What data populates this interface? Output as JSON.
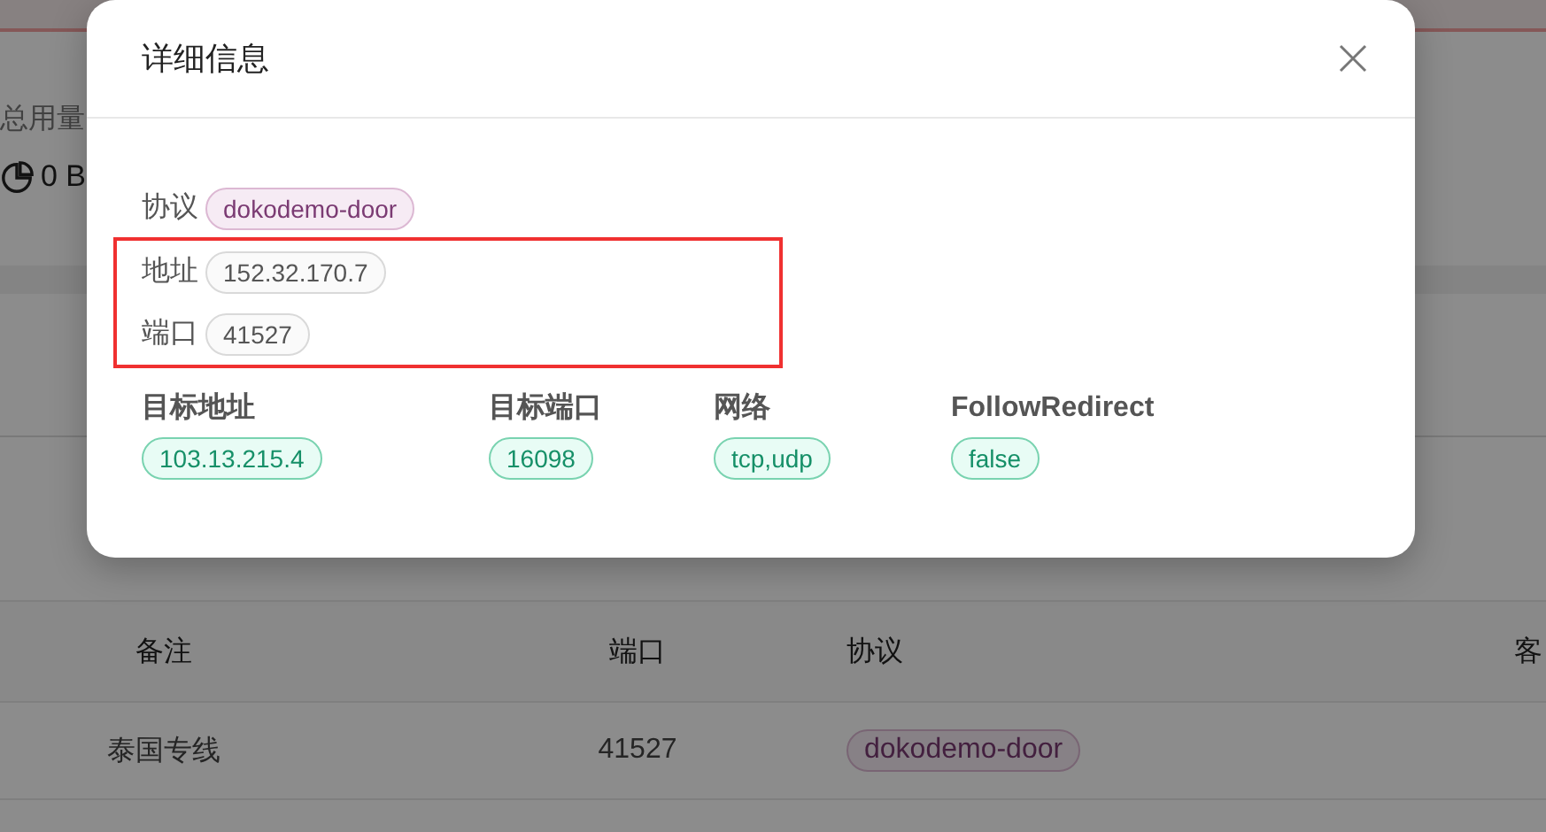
{
  "background": {
    "usage_label": "总用量",
    "usage_value": "0 B",
    "table": {
      "columns": [
        "备注",
        "端口",
        "协议",
        "客"
      ],
      "rows": [
        {
          "remark": "泰国专线",
          "port": "41527",
          "protocol": "dokodemo-door"
        }
      ]
    }
  },
  "dialog": {
    "title": "详细信息",
    "fields": [
      {
        "label": "协议",
        "value": "dokodemo-door",
        "kind": "protocol",
        "highlighted": false
      },
      {
        "label": "地址",
        "value": "152.32.170.7",
        "kind": "plain",
        "highlighted": true
      },
      {
        "label": "端口",
        "value": "41527",
        "kind": "plain",
        "highlighted": true
      }
    ],
    "settings": [
      {
        "label": "目标地址",
        "value": "103.13.215.4"
      },
      {
        "label": "目标端口",
        "value": "16098"
      },
      {
        "label": "网络",
        "value": "tcp,udp"
      },
      {
        "label": "FollowRedirect",
        "value": "false"
      }
    ]
  }
}
